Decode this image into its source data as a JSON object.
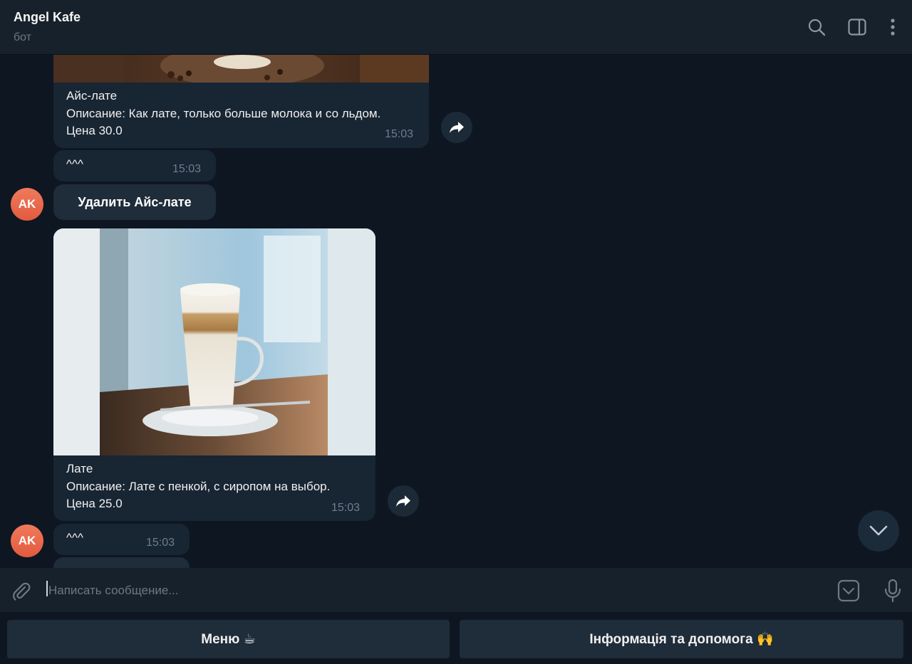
{
  "header": {
    "title": "Angel Kafe",
    "status": "бот",
    "icons": [
      "search-icon",
      "sidebar-toggle-icon",
      "more-vertical-icon"
    ]
  },
  "messages": [
    {
      "type": "product",
      "name": "Айс-лате",
      "description": "Описание: Как лате, только больше молока и со льдом.",
      "price": "Цена 30.0",
      "time": "15:03"
    },
    {
      "type": "text",
      "text": "^^^",
      "time": "15:03",
      "avatar": "AK"
    },
    {
      "type": "inline_button",
      "label": "Удалить Айс-лате"
    },
    {
      "type": "product",
      "name": "Лате",
      "description": "Описание: Лате с пенкой, с сиропом на выбор.",
      "price": "Цена 25.0",
      "time": "15:03"
    },
    {
      "type": "text",
      "text": "^^^",
      "time": "15:03",
      "avatar": "AK"
    }
  ],
  "composer": {
    "placeholder": "Написать сообщение...",
    "icons": [
      "attach-icon",
      "bot-keyboard-icon",
      "microphone-icon"
    ]
  },
  "keyboard": {
    "buttons": [
      "Меню ☕",
      "Інформація та допомога 🙌"
    ]
  },
  "colors": {
    "background": "#0e1621",
    "header": "#17212b",
    "bubble": "#182533",
    "avatar": "#e8674a",
    "accent_text": "#6d7f8f"
  }
}
